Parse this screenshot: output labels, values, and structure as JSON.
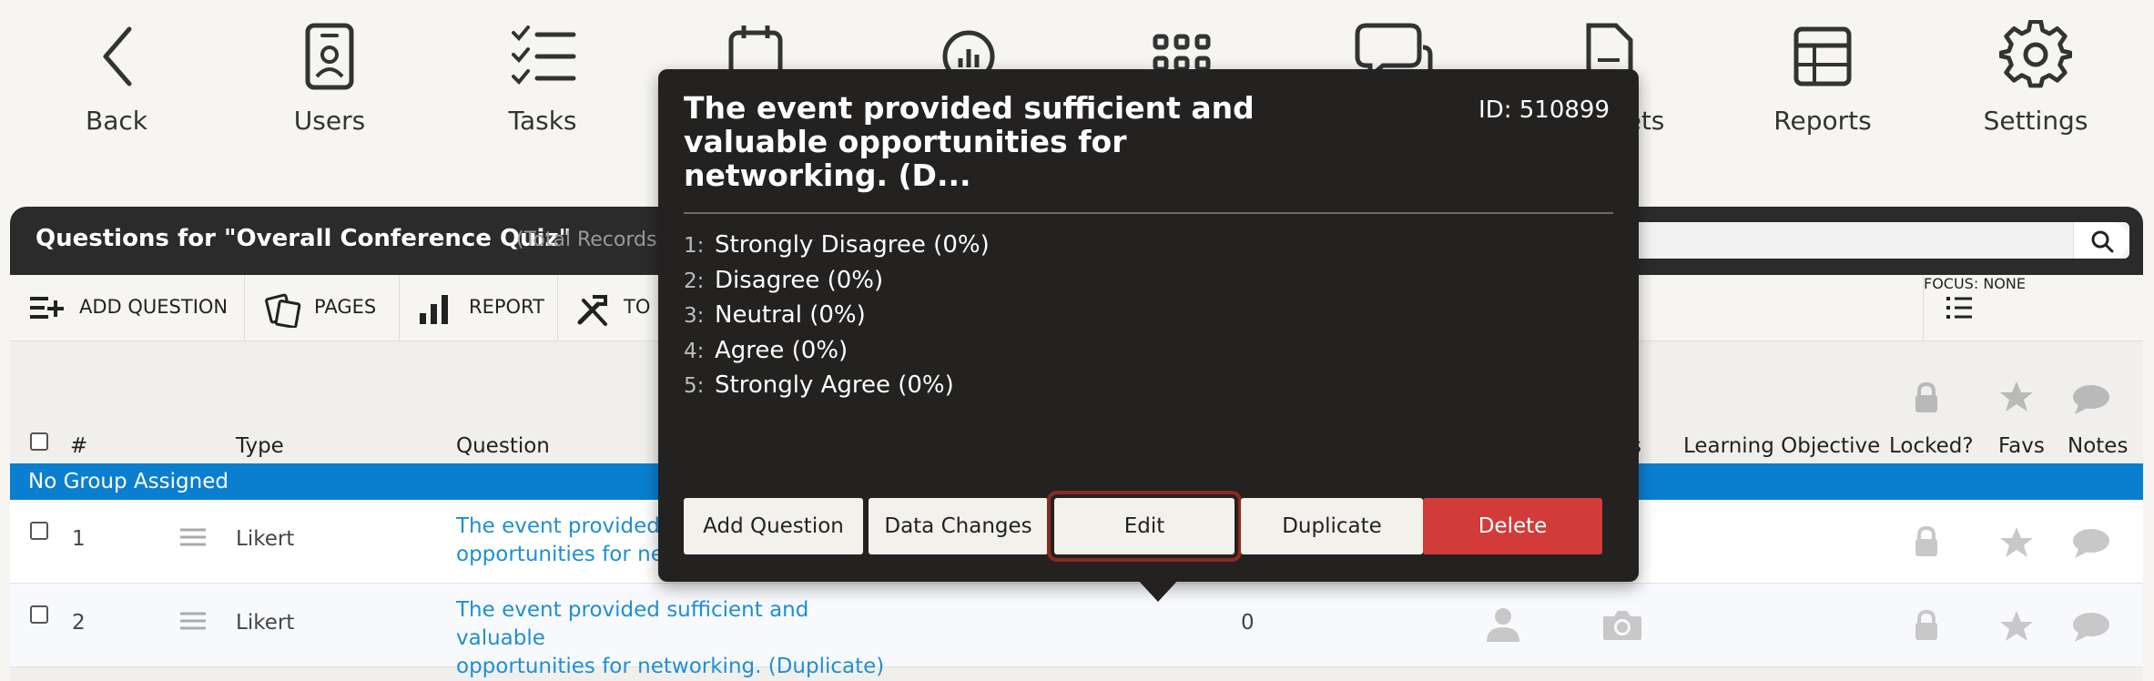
{
  "nav": {
    "back": "Back",
    "users": "Users",
    "tasks": "Tasks",
    "buckets_partial": "ets",
    "reports": "Reports",
    "settings": "Settings"
  },
  "panel": {
    "title": "Questions for \"Overall Conference Quiz\"",
    "total_partial": "(Total Records:",
    "search": {
      "placeholder": "",
      "value": ""
    }
  },
  "toolbar": {
    "add_question": "ADD QUESTION",
    "pages": "PAGES",
    "report": "REPORT",
    "tools_partial": "TO",
    "focus": "FOCUS: NONE"
  },
  "table": {
    "headers": {
      "number": "#",
      "type": "Type",
      "question": "Question",
      "partial_s": "s",
      "learning_objective": "Learning Objective",
      "locked": "Locked?",
      "favs": "Favs",
      "notes": "Notes"
    },
    "group": "No Group Assigned",
    "rows": [
      {
        "number": "1",
        "type": "Likert",
        "question_line1": "The event provided s",
        "question_line2": "opportunities for netw",
        "count": ""
      },
      {
        "number": "2",
        "type": "Likert",
        "question_line1": "The event provided sufficient and valuable",
        "question_line2": "opportunities for networking. (Duplicate)",
        "count": "0"
      }
    ]
  },
  "popover": {
    "title": "The event provided sufficient and valuable opportunities for networking. (D...",
    "id": "ID: 510899",
    "options": [
      {
        "num": "1:",
        "label": "Strongly Disagree (0%)"
      },
      {
        "num": "2:",
        "label": "Disagree (0%)"
      },
      {
        "num": "3:",
        "label": "Neutral (0%)"
      },
      {
        "num": "4:",
        "label": "Agree (0%)"
      },
      {
        "num": "5:",
        "label": "Strongly Agree (0%)"
      }
    ],
    "buttons": {
      "add_question": "Add Question",
      "data_changes": "Data Changes",
      "edit": "Edit",
      "duplicate": "Duplicate",
      "delete": "Delete"
    }
  },
  "colors": {
    "header_bg": "#2b2b2b",
    "group_bar": "#0a7fd0",
    "link": "#1f8fd1",
    "popover_bg": "#232221",
    "delete": "#d33b3b",
    "edit_highlight": "#8c2a1e"
  },
  "icons": [
    "chevron-left-icon",
    "user-badge-icon",
    "checklist-icon",
    "calendar-icon",
    "poll-icon",
    "grid-icon",
    "chat-icon",
    "document-icon",
    "table-icon",
    "gear-icon",
    "search-icon",
    "add-list-icon",
    "pages-icon",
    "bar-chart-icon",
    "tools-icon",
    "list-icon",
    "lock-icon",
    "star-icon",
    "comment-icon",
    "drag-handle-icon",
    "person-icon",
    "camera-icon"
  ]
}
